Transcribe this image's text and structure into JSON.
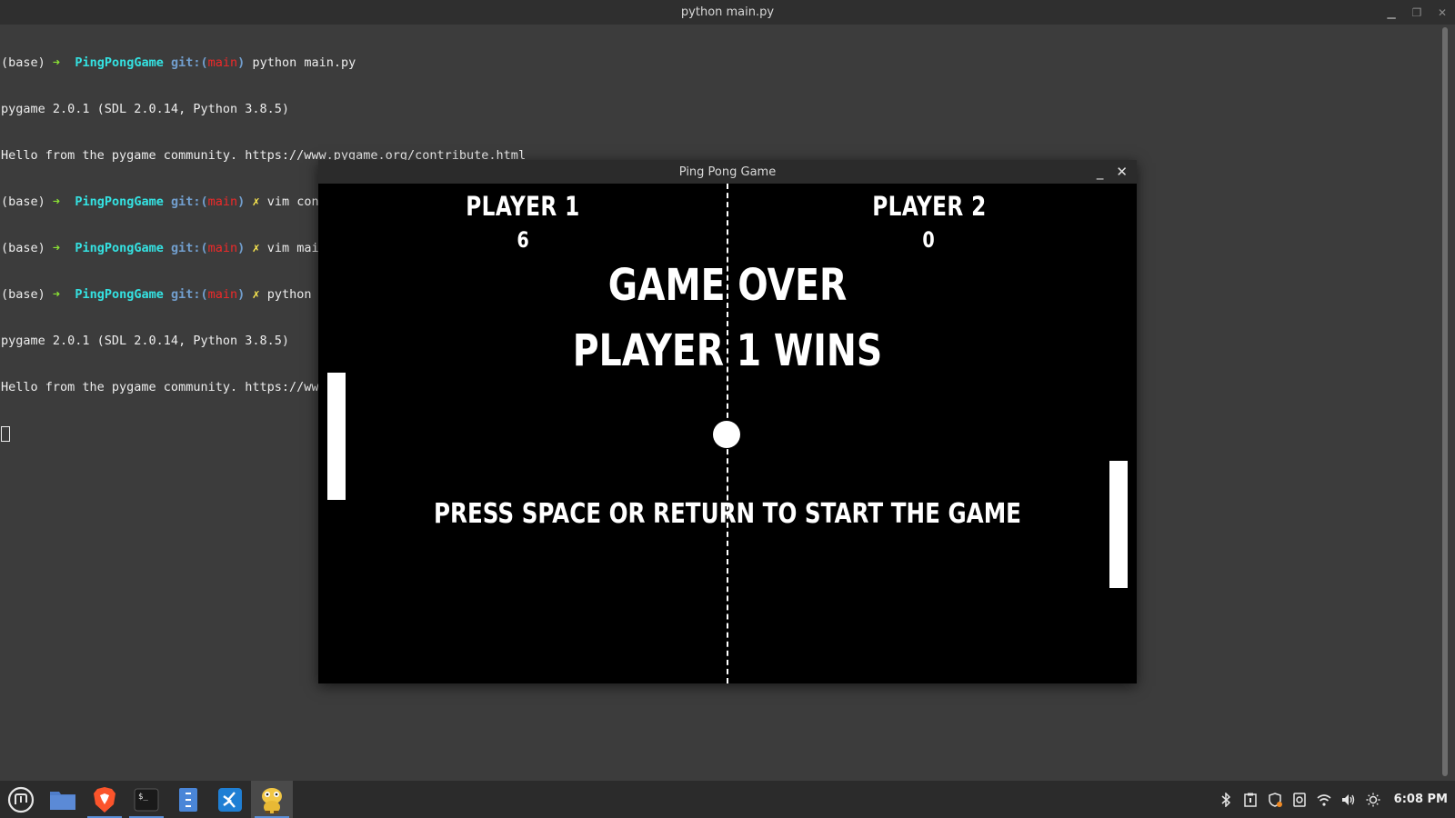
{
  "terminal": {
    "title": "python main.py",
    "lines": [
      {
        "type": "prompt",
        "base": "(base)",
        "arrow": "➜",
        "dir": "PingPongGame",
        "git": "git:(",
        "branch": "main",
        "git_close": ")",
        "dirty": "",
        "cmd": "python main.py"
      },
      {
        "type": "out",
        "text": "pygame 2.0.1 (SDL 2.0.14, Python 3.8.5)"
      },
      {
        "type": "out",
        "text": "Hello from the pygame community. https://www.pygame.org/contribute.html"
      },
      {
        "type": "prompt",
        "base": "(base)",
        "arrow": "➜",
        "dir": "PingPongGame",
        "git": "git:(",
        "branch": "main",
        "git_close": ")",
        "dirty": "✗",
        "cmd": "vim constants.py"
      },
      {
        "type": "prompt",
        "base": "(base)",
        "arrow": "➜",
        "dir": "PingPongGame",
        "git": "git:(",
        "branch": "main",
        "git_close": ")",
        "dirty": "✗",
        "cmd": "vim main.py"
      },
      {
        "type": "prompt",
        "base": "(base)",
        "arrow": "➜",
        "dir": "PingPongGame",
        "git": "git:(",
        "branch": "main",
        "git_close": ")",
        "dirty": "✗",
        "cmd": "python main.py"
      },
      {
        "type": "out",
        "text": "pygame 2.0.1 (SDL 2.0.14, Python 3.8.5)"
      },
      {
        "type": "out",
        "text": "Hello from the pygame community. https://www.pygame.org/contribute.html"
      }
    ]
  },
  "game": {
    "window_title": "Ping Pong Game",
    "player1_label": "PLAYER 1",
    "player2_label": "PLAYER 2",
    "player1_score": "6",
    "player2_score": "0",
    "game_over": "GAME OVER",
    "winner": "PLAYER 1 WINS",
    "prompt": "PRESS SPACE OR RETURN TO START THE GAME"
  },
  "taskbar": {
    "items": [
      "mint-menu-icon",
      "files-icon",
      "brave-browser-icon",
      "terminal-icon",
      "text-editor-icon",
      "vscode-icon",
      "pygame-icon"
    ],
    "clock": "6:08 PM",
    "tray_icons": [
      "bluetooth-icon",
      "clipboard-icon",
      "shield-update-icon",
      "drive-icon",
      "wifi-icon",
      "volume-icon",
      "brightness-icon"
    ]
  },
  "colors": {
    "terminal_bg": "#3c3c3c",
    "prompt_arrow": "#8ae234",
    "prompt_dir": "#34e2e2",
    "prompt_git": "#729fcf",
    "prompt_branch": "#ef2929",
    "prompt_dirty": "#fce94f",
    "game_bg": "#000000"
  }
}
